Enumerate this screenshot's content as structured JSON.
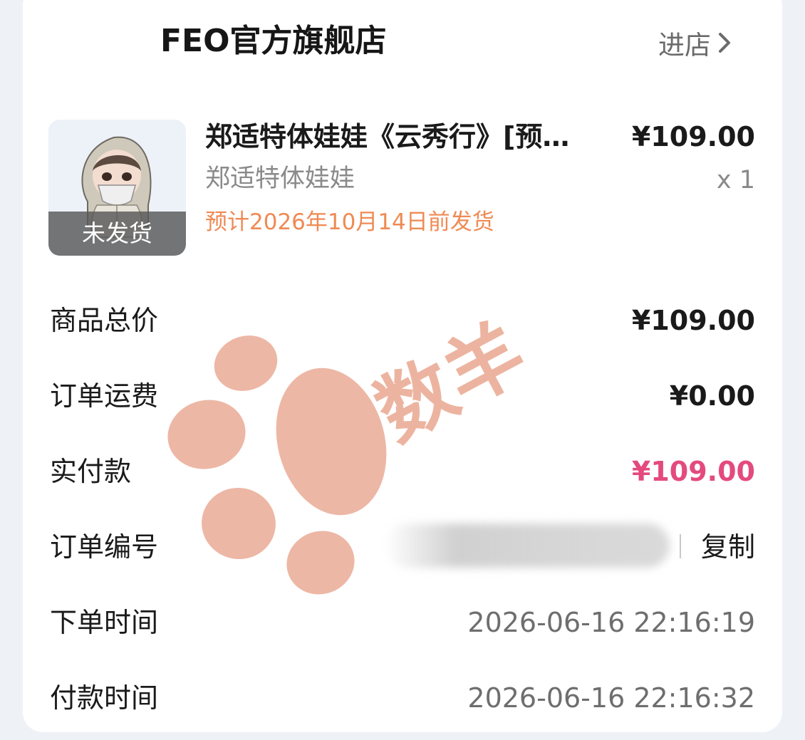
{
  "store": {
    "name": "FEO官方旗舰店",
    "enter_label": "进店"
  },
  "product": {
    "title": "郑适特体娃娃《云秀行》[预…",
    "sku": "郑适特体娃娃",
    "eta": "预计2026年10月14日前发货",
    "price": "¥109.00",
    "quantity": "x 1",
    "status_badge": "未发货"
  },
  "summary": {
    "goods_total_label": "商品总价",
    "goods_total_value": "¥109.00",
    "shipping_label": "订单运费",
    "shipping_value": "¥0.00",
    "paid_label": "实付款",
    "paid_value": "¥109.00"
  },
  "order": {
    "number_label": "订单编号",
    "copy_label": "复制",
    "created_label": "下单时间",
    "created_value": "2026-06-16 22:16:19",
    "paid_time_label": "付款时间",
    "paid_time_value": "2026-06-16 22:16:32"
  },
  "watermark": {
    "text": "数羊"
  },
  "colors": {
    "page_bg": "#eef1f6",
    "card_bg": "#ffffff",
    "eta_orange": "#ef8a54",
    "paid_pink": "#e44a7d",
    "watermark_peach": "#e9a48c"
  }
}
